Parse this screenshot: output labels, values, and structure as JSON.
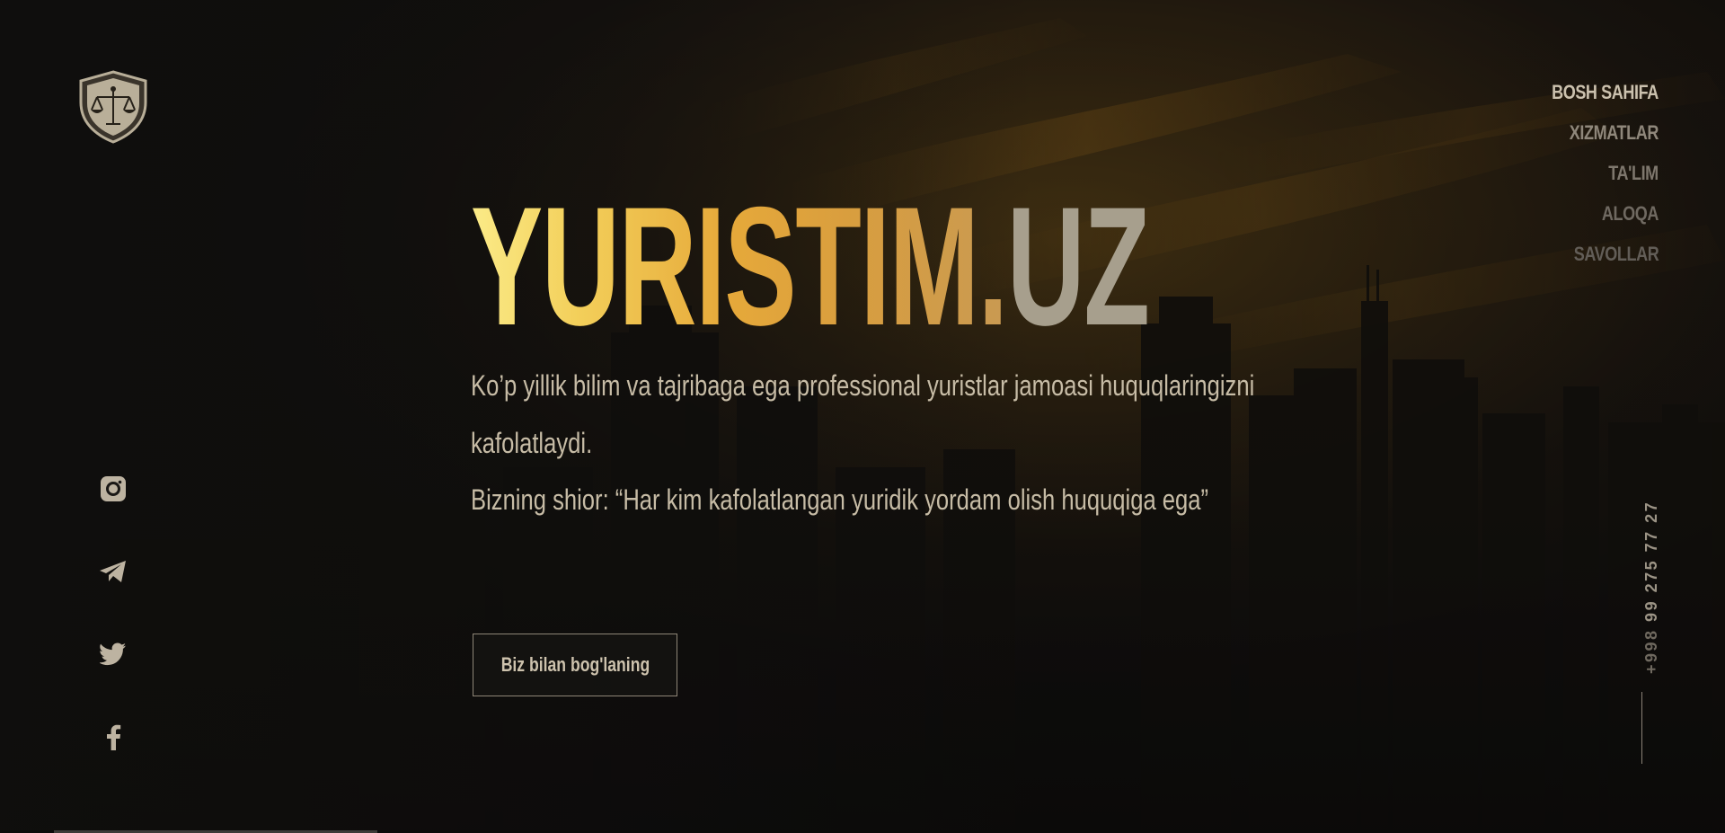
{
  "brand": {
    "logo_icon": "scales-of-justice-shield-icon"
  },
  "nav": {
    "items": [
      {
        "label": "BOSH SAHIFA"
      },
      {
        "label": "XIZMATLAR"
      },
      {
        "label": "TA'LIM"
      },
      {
        "label": "ALOQA"
      },
      {
        "label": "SAVOLLAR"
      }
    ]
  },
  "social": {
    "icons": [
      "instagram-icon",
      "telegram-icon",
      "twitter-icon",
      "facebook-icon"
    ]
  },
  "hero": {
    "title_main": "YURISTIM.",
    "title_tld": "UZ",
    "description": "Ko’p yillik bilim va tajribaga ega professional yuristlar jamoasi huquqlaringizni kafolatlaydi.",
    "slogan": "Bizning shior: “Har kim kafolatlangan yuridik yordam olish huquqiga ega”",
    "cta_label": "Biz bilan bog'laning"
  },
  "contact": {
    "phone_code": "+998",
    "phone_number": "99 275 77 27"
  },
  "colors": {
    "background": "#121110",
    "gold_start": "#fbeb88",
    "gold_end": "#c99a52",
    "text": "#c7bca6"
  }
}
